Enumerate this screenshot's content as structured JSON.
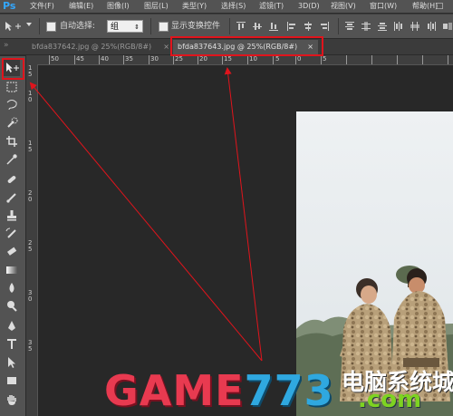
{
  "app": {
    "logo": "Ps"
  },
  "menu": [
    "文件(F)",
    "编辑(E)",
    "图像(I)",
    "图层(L)",
    "类型(Y)",
    "选择(S)",
    "滤镜(T)",
    "3D(D)",
    "视图(V)",
    "窗口(W)",
    "帮助(H)"
  ],
  "window_controls": {
    "minimize": "–",
    "maximize": "□"
  },
  "options": {
    "auto_select_label": "自动选择:",
    "auto_select_value": "组",
    "transform_label": "显示变换控件"
  },
  "tabs": [
    {
      "label": "bfda837642.jpg @ 25%(RGB/8#)",
      "close": "×",
      "active": false
    },
    {
      "label": "bfda837643.jpg @ 25%(RGB/8#)",
      "close": "×",
      "active": true
    }
  ],
  "ruler_h": [
    "50",
    "45",
    "40",
    "35",
    "30",
    "25",
    "20",
    "15",
    "10",
    "5",
    "0",
    "5"
  ],
  "ruler_v": [
    "1",
    "5",
    "1",
    "0",
    "1",
    "5",
    "2",
    "0",
    "2",
    "5",
    "3",
    "0",
    "3",
    "5"
  ],
  "watermark": {
    "main": "GAME773",
    "cn": "电脑系统城",
    "com": ".com"
  },
  "colors": {
    "annotation_red": "#e0141c",
    "ps_blue": "#33a7ff",
    "watermark_green": "#7ed321"
  },
  "tools": [
    "move-tool",
    "marquee-tool",
    "lasso-tool",
    "quick-select-tool",
    "crop-tool",
    "eyedropper-tool",
    "healing-brush-tool",
    "brush-tool",
    "clone-stamp-tool",
    "history-brush-tool",
    "eraser-tool",
    "gradient-tool",
    "blur-tool",
    "dodge-tool",
    "pen-tool",
    "type-tool",
    "path-select-tool",
    "rectangle-tool",
    "hand-tool"
  ]
}
